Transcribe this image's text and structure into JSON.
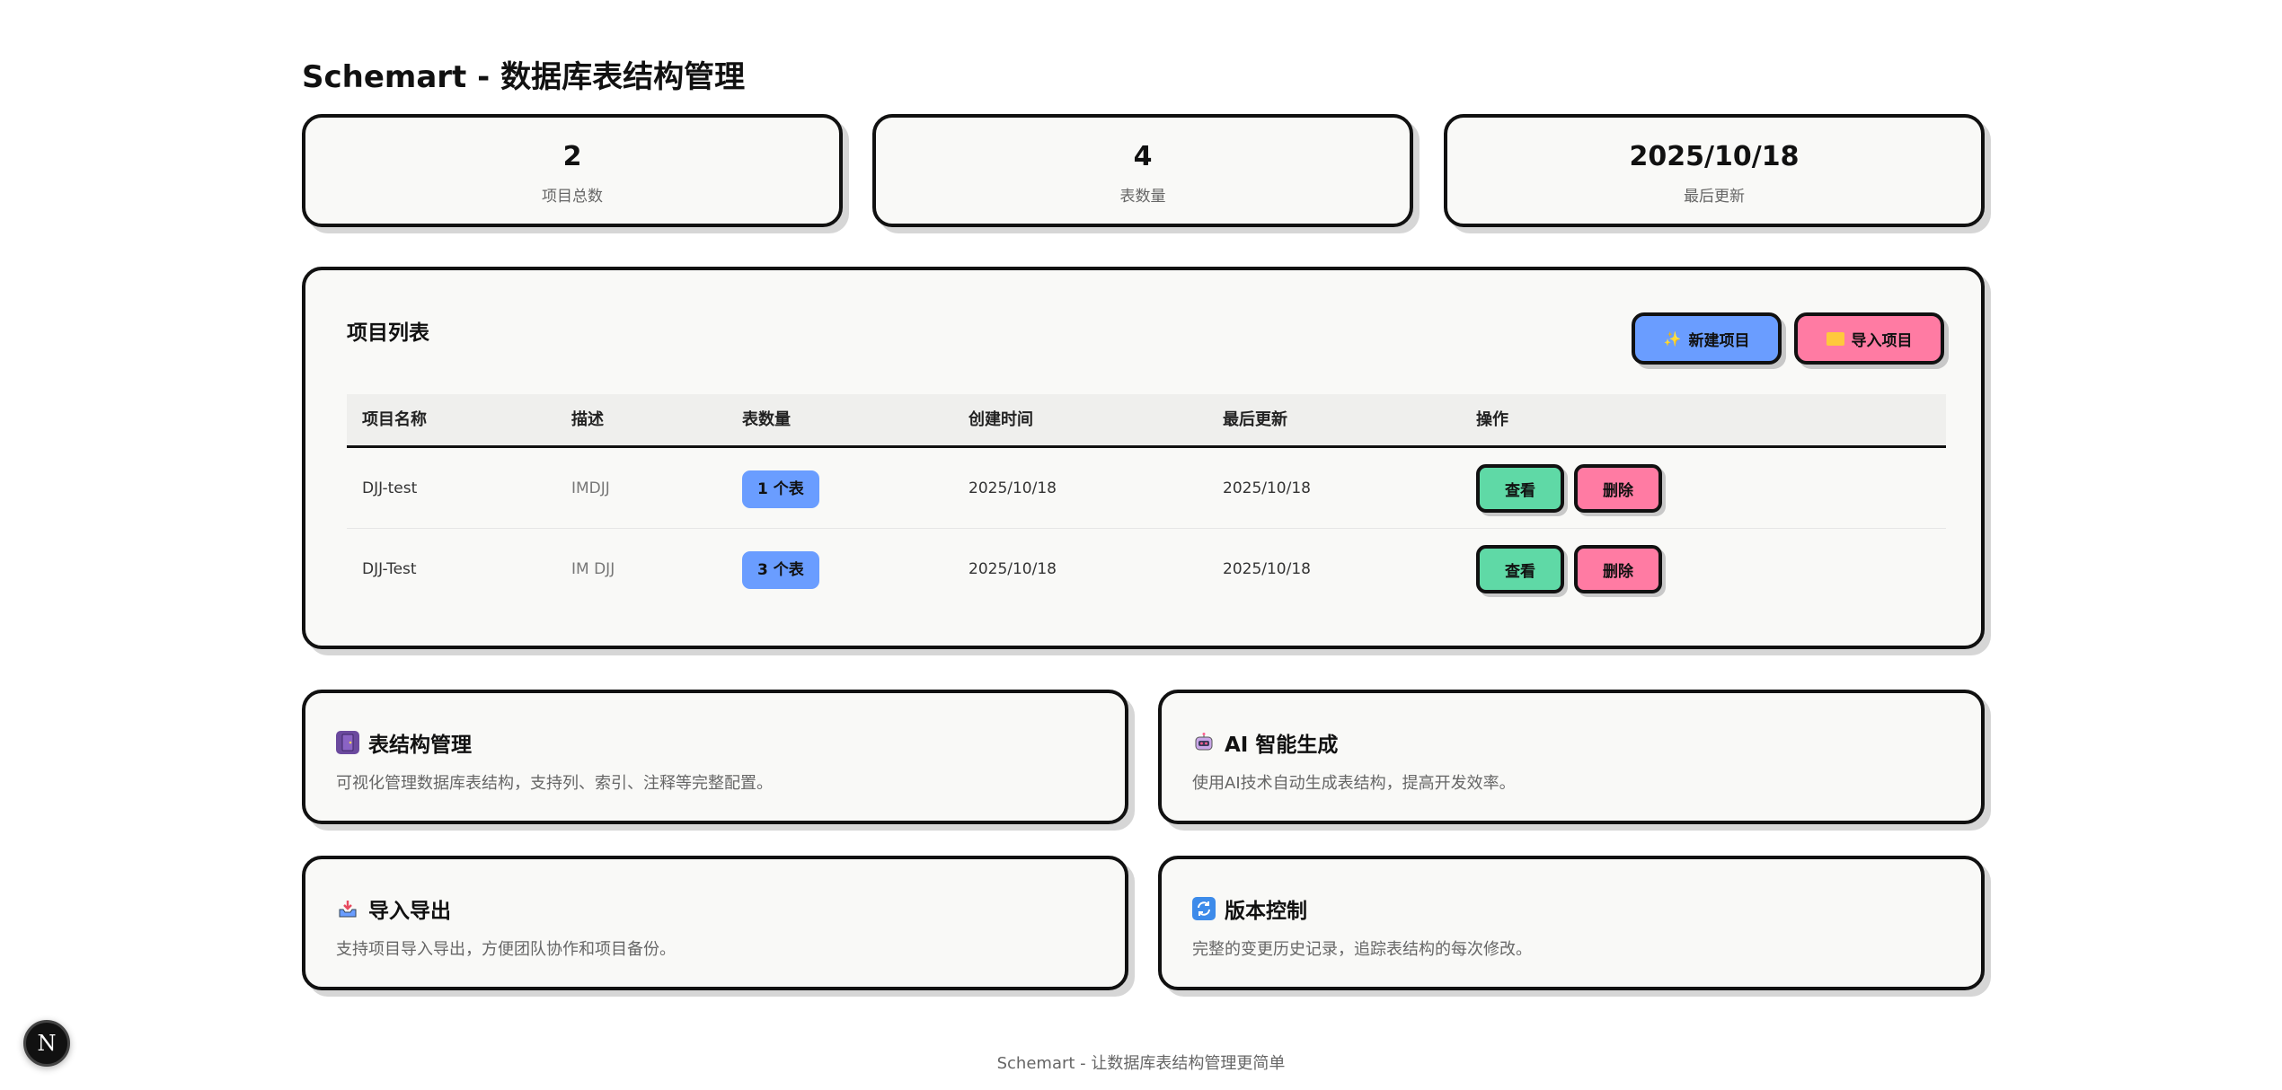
{
  "header": {
    "title": "Schemart - 数据库表结构管理"
  },
  "stats": [
    {
      "value": "2",
      "label": "项目总数"
    },
    {
      "value": "4",
      "label": "表数量"
    },
    {
      "value": "2025/10/18",
      "label": "最后更新"
    }
  ],
  "projects": {
    "title": "项目列表",
    "new_button": "新建项目",
    "import_button": "导入项目",
    "columns": [
      "项目名称",
      "描述",
      "表数量",
      "创建时间",
      "最后更新",
      "操作"
    ],
    "rows": [
      {
        "name": "DJJ-test",
        "description": "IMDJJ",
        "tables": "1 个表",
        "created": "2025/10/18",
        "updated": "2025/10/18",
        "view": "查看",
        "delete": "删除"
      },
      {
        "name": "DJJ-Test",
        "description": "IM DJJ",
        "tables": "3 个表",
        "created": "2025/10/18",
        "updated": "2025/10/18",
        "view": "查看",
        "delete": "删除"
      }
    ]
  },
  "features": [
    {
      "icon": "door-icon",
      "title": "表结构管理",
      "description": "可视化管理数据库表结构，支持列、索引、注释等完整配置。"
    },
    {
      "icon": "robot-icon",
      "title": "AI 智能生成",
      "description": "使用AI技术自动生成表结构，提高开发效率。"
    },
    {
      "icon": "inbox-tray-icon",
      "title": "导入导出",
      "description": "支持项目导入导出，方便团队协作和项目备份。"
    },
    {
      "icon": "refresh-icon",
      "title": "版本控制",
      "description": "完整的变更历史记录，追踪表结构的每次修改。"
    }
  ],
  "footer": {
    "text": "Schemart - 让数据库表结构管理更简单"
  },
  "dev_badge": {
    "label": "N"
  },
  "colors": {
    "blue": "#6a9dff",
    "pink": "#ff7ba3",
    "green": "#5fd9a6",
    "card_bg": "#f9f9f7"
  }
}
